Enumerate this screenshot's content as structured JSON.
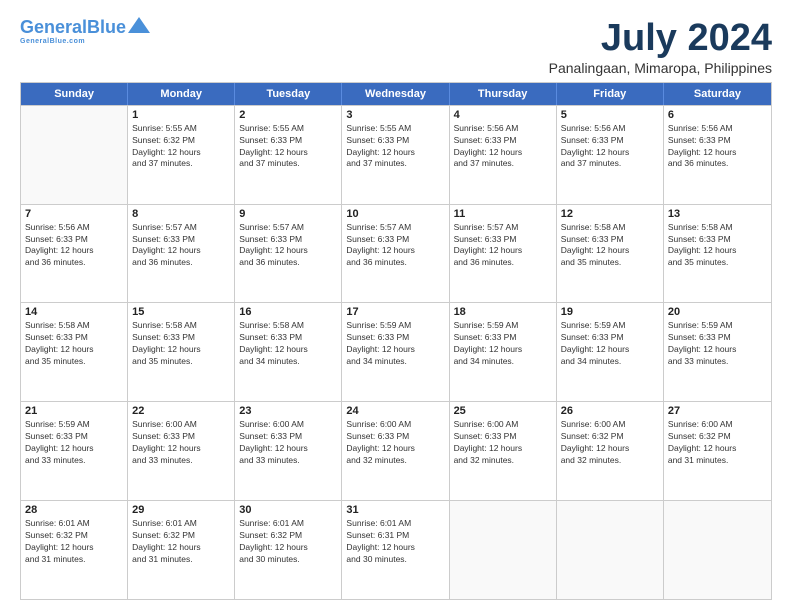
{
  "header": {
    "logo_line1": "General",
    "logo_line2": "Blue",
    "month": "July 2024",
    "location": "Panalingaan, Mimaropa, Philippines"
  },
  "weekdays": [
    "Sunday",
    "Monday",
    "Tuesday",
    "Wednesday",
    "Thursday",
    "Friday",
    "Saturday"
  ],
  "rows": [
    [
      {
        "day": "",
        "lines": []
      },
      {
        "day": "1",
        "lines": [
          "Sunrise: 5:55 AM",
          "Sunset: 6:32 PM",
          "Daylight: 12 hours",
          "and 37 minutes."
        ]
      },
      {
        "day": "2",
        "lines": [
          "Sunrise: 5:55 AM",
          "Sunset: 6:33 PM",
          "Daylight: 12 hours",
          "and 37 minutes."
        ]
      },
      {
        "day": "3",
        "lines": [
          "Sunrise: 5:55 AM",
          "Sunset: 6:33 PM",
          "Daylight: 12 hours",
          "and 37 minutes."
        ]
      },
      {
        "day": "4",
        "lines": [
          "Sunrise: 5:56 AM",
          "Sunset: 6:33 PM",
          "Daylight: 12 hours",
          "and 37 minutes."
        ]
      },
      {
        "day": "5",
        "lines": [
          "Sunrise: 5:56 AM",
          "Sunset: 6:33 PM",
          "Daylight: 12 hours",
          "and 37 minutes."
        ]
      },
      {
        "day": "6",
        "lines": [
          "Sunrise: 5:56 AM",
          "Sunset: 6:33 PM",
          "Daylight: 12 hours",
          "and 36 minutes."
        ]
      }
    ],
    [
      {
        "day": "7",
        "lines": [
          "Sunrise: 5:56 AM",
          "Sunset: 6:33 PM",
          "Daylight: 12 hours",
          "and 36 minutes."
        ]
      },
      {
        "day": "8",
        "lines": [
          "Sunrise: 5:57 AM",
          "Sunset: 6:33 PM",
          "Daylight: 12 hours",
          "and 36 minutes."
        ]
      },
      {
        "day": "9",
        "lines": [
          "Sunrise: 5:57 AM",
          "Sunset: 6:33 PM",
          "Daylight: 12 hours",
          "and 36 minutes."
        ]
      },
      {
        "day": "10",
        "lines": [
          "Sunrise: 5:57 AM",
          "Sunset: 6:33 PM",
          "Daylight: 12 hours",
          "and 36 minutes."
        ]
      },
      {
        "day": "11",
        "lines": [
          "Sunrise: 5:57 AM",
          "Sunset: 6:33 PM",
          "Daylight: 12 hours",
          "and 36 minutes."
        ]
      },
      {
        "day": "12",
        "lines": [
          "Sunrise: 5:58 AM",
          "Sunset: 6:33 PM",
          "Daylight: 12 hours",
          "and 35 minutes."
        ]
      },
      {
        "day": "13",
        "lines": [
          "Sunrise: 5:58 AM",
          "Sunset: 6:33 PM",
          "Daylight: 12 hours",
          "and 35 minutes."
        ]
      }
    ],
    [
      {
        "day": "14",
        "lines": [
          "Sunrise: 5:58 AM",
          "Sunset: 6:33 PM",
          "Daylight: 12 hours",
          "and 35 minutes."
        ]
      },
      {
        "day": "15",
        "lines": [
          "Sunrise: 5:58 AM",
          "Sunset: 6:33 PM",
          "Daylight: 12 hours",
          "and 35 minutes."
        ]
      },
      {
        "day": "16",
        "lines": [
          "Sunrise: 5:58 AM",
          "Sunset: 6:33 PM",
          "Daylight: 12 hours",
          "and 34 minutes."
        ]
      },
      {
        "day": "17",
        "lines": [
          "Sunrise: 5:59 AM",
          "Sunset: 6:33 PM",
          "Daylight: 12 hours",
          "and 34 minutes."
        ]
      },
      {
        "day": "18",
        "lines": [
          "Sunrise: 5:59 AM",
          "Sunset: 6:33 PM",
          "Daylight: 12 hours",
          "and 34 minutes."
        ]
      },
      {
        "day": "19",
        "lines": [
          "Sunrise: 5:59 AM",
          "Sunset: 6:33 PM",
          "Daylight: 12 hours",
          "and 34 minutes."
        ]
      },
      {
        "day": "20",
        "lines": [
          "Sunrise: 5:59 AM",
          "Sunset: 6:33 PM",
          "Daylight: 12 hours",
          "and 33 minutes."
        ]
      }
    ],
    [
      {
        "day": "21",
        "lines": [
          "Sunrise: 5:59 AM",
          "Sunset: 6:33 PM",
          "Daylight: 12 hours",
          "and 33 minutes."
        ]
      },
      {
        "day": "22",
        "lines": [
          "Sunrise: 6:00 AM",
          "Sunset: 6:33 PM",
          "Daylight: 12 hours",
          "and 33 minutes."
        ]
      },
      {
        "day": "23",
        "lines": [
          "Sunrise: 6:00 AM",
          "Sunset: 6:33 PM",
          "Daylight: 12 hours",
          "and 33 minutes."
        ]
      },
      {
        "day": "24",
        "lines": [
          "Sunrise: 6:00 AM",
          "Sunset: 6:33 PM",
          "Daylight: 12 hours",
          "and 32 minutes."
        ]
      },
      {
        "day": "25",
        "lines": [
          "Sunrise: 6:00 AM",
          "Sunset: 6:33 PM",
          "Daylight: 12 hours",
          "and 32 minutes."
        ]
      },
      {
        "day": "26",
        "lines": [
          "Sunrise: 6:00 AM",
          "Sunset: 6:32 PM",
          "Daylight: 12 hours",
          "and 32 minutes."
        ]
      },
      {
        "day": "27",
        "lines": [
          "Sunrise: 6:00 AM",
          "Sunset: 6:32 PM",
          "Daylight: 12 hours",
          "and 31 minutes."
        ]
      }
    ],
    [
      {
        "day": "28",
        "lines": [
          "Sunrise: 6:01 AM",
          "Sunset: 6:32 PM",
          "Daylight: 12 hours",
          "and 31 minutes."
        ]
      },
      {
        "day": "29",
        "lines": [
          "Sunrise: 6:01 AM",
          "Sunset: 6:32 PM",
          "Daylight: 12 hours",
          "and 31 minutes."
        ]
      },
      {
        "day": "30",
        "lines": [
          "Sunrise: 6:01 AM",
          "Sunset: 6:32 PM",
          "Daylight: 12 hours",
          "and 30 minutes."
        ]
      },
      {
        "day": "31",
        "lines": [
          "Sunrise: 6:01 AM",
          "Sunset: 6:31 PM",
          "Daylight: 12 hours",
          "and 30 minutes."
        ]
      },
      {
        "day": "",
        "lines": []
      },
      {
        "day": "",
        "lines": []
      },
      {
        "day": "",
        "lines": []
      }
    ]
  ]
}
